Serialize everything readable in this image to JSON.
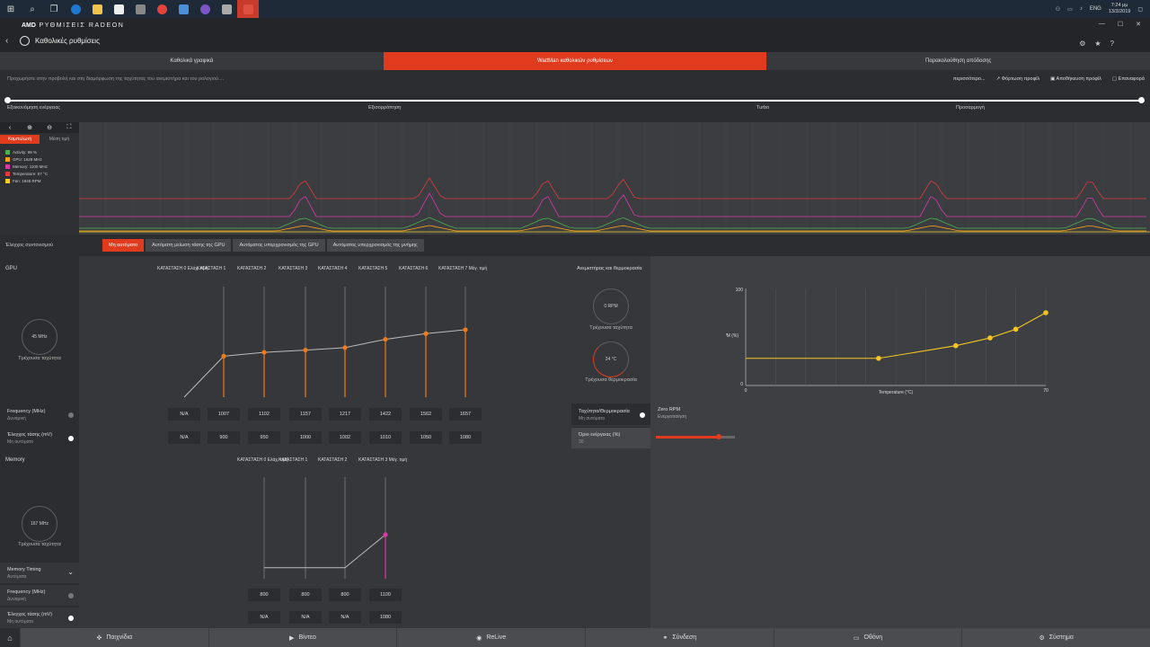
{
  "taskbar": {
    "icons": [
      "windows-icon",
      "search-icon",
      "task-view-icon",
      "edge-icon",
      "file-explorer-icon",
      "mail-icon",
      "calculator-icon",
      "chrome-icon",
      "store-icon",
      "viber-icon",
      "photos-icon",
      "radeon-icon"
    ],
    "lang": "ENG",
    "time": "7:24 μμ",
    "date": "13/3/2019"
  },
  "app": {
    "brand_bold": "AMD",
    "brand": "ΡΥΘΜΙΣΕΙΣ RADEON",
    "breadcrumb": "Καθολικές ρυθμίσεις"
  },
  "tabs": [
    "Καθολικά γραφικά",
    "WattMan καθολικών ρυθμίσεων",
    "Παρακολούθηση απόδοσης"
  ],
  "subbar": {
    "hint": "Προχωρήστε στην προβολή και στη διαμόρφωση της ταχύτητας του ανεμιστήρα και του ρολογιού....",
    "more": "περισσότερο...",
    "load": "Φόρτωση προφίλ",
    "save": "Αποθήκευση προφίλ",
    "reset": "Επαναφορά"
  },
  "presets": [
    "Εξοικονόμηση ενέργειας",
    "Εξισορρόπηση",
    "Turbo",
    "Προσαρμογή"
  ],
  "graph": {
    "mode_curve": "Καμπυλωτή",
    "mode_avg": "Μέση τιμή",
    "legend": [
      {
        "label": "Activity: 99 %",
        "color": "#4caf50"
      },
      {
        "label": "GPU: 1628 MHz",
        "color": "#f7a21b"
      },
      {
        "label": "Memory: 1100 MHz",
        "color": "#d63aa6"
      },
      {
        "label": "Temperature: 57 °C",
        "color": "#e03b3b"
      },
      {
        "label": "Fan: 1846 RPM",
        "color": "#f5d020"
      }
    ]
  },
  "fan_control": {
    "label": "Έλεγχος συντονισμού",
    "options": [
      "Μη αυτόματο",
      "Αυτόματη μείωση τάσης της GPU",
      "Αυτόματος υπερχρονισμός της GPU",
      "Αυτόματος υπερχρονισμός της μνήμης"
    ]
  },
  "gpu": {
    "title": "GPU",
    "speed": "45 MHz",
    "speed_label": "Τρέχουσα ταχύτητα",
    "freq_title": "Frequency (MHz)",
    "freq_sub": "Δυναμική",
    "volt_title": "Έλεγχος τάσης (mV)",
    "volt_sub": "Μη αυτόματο",
    "states": [
      "ΚΑΤΑΣΤΑΣΗ 0 Ελάχ. τιμή",
      "ΚΑΤΑΣΤΑΣΗ 1",
      "ΚΑΤΑΣΤΑΣΗ 2",
      "ΚΑΤΑΣΤΑΣΗ 3",
      "ΚΑΤΑΣΤΑΣΗ 4",
      "ΚΑΤΑΣΤΑΣΗ 5",
      "ΚΑΤΑΣΤΑΣΗ 6",
      "ΚΑΤΑΣΤΑΣΗ 7 Μέγ. τιμή"
    ],
    "freq": [
      "N/A",
      "1007",
      "1102",
      "1157",
      "1217",
      "1422",
      "1562",
      "1657"
    ],
    "volt": [
      "N/A",
      "900",
      "950",
      "1000",
      "1002",
      "1010",
      "1050",
      "1080"
    ]
  },
  "memory": {
    "title": "Memory",
    "speed": "167 MHz",
    "speed_label": "Τρέχουσα ταχύτητα",
    "timing_title": "Memory Timing",
    "timing_sub": "Αυτόματα",
    "freq_title": "Frequency (MHz)",
    "freq_sub": "Δυναμική",
    "volt_title": "Έλεγχος τάσης (mV)",
    "volt_sub": "Μη αυτόματο",
    "states": [
      "ΚΑΤΑΣΤΑΣΗ 0 Ελάχ. τιμή",
      "ΚΑΤΑΣΤΑΣΗ 1",
      "ΚΑΤΑΣΤΑΣΗ 2",
      "ΚΑΤΑΣΤΑΣΗ 3 Μέγ. τιμή"
    ],
    "freq": [
      "800",
      "800",
      "800",
      "1100"
    ],
    "volt": [
      "N/A",
      "N/A",
      "N/A",
      "1080"
    ]
  },
  "fan": {
    "title": "Ανεμιστήρας και θερμοκρασία",
    "rpm": "0 RPM",
    "rpm_label": "Τρέχουσα ταχύτητα",
    "temp": "24 °C",
    "temp_label": "Τρέχουσα θερμοκρασία",
    "speed_temp_title": "Ταχύτητα/Θερμοκρασία",
    "speed_temp_sub": "Μη αυτόματο",
    "zero_rpm_title": "Zero RPM",
    "zero_rpm_sub": "Ενεργοποίηση",
    "power_title": "Όριο ενέργειας (%)",
    "power_value": "30",
    "power_fraction": 0.8,
    "y_label": "PWM (%)",
    "x_label": "Temperature (°C)",
    "y_max": "100",
    "y_min": "0",
    "x_min": "0",
    "x_max": "70"
  },
  "bottom": [
    {
      "label": "Παιχνίδια",
      "icon": "gamepad-icon"
    },
    {
      "label": "Βίντεο",
      "icon": "play-icon"
    },
    {
      "label": "ReLive",
      "icon": "relive-icon"
    },
    {
      "label": "Σύνδεση",
      "icon": "connect-icon"
    },
    {
      "label": "Οθόνη",
      "icon": "monitor-icon"
    },
    {
      "label": "Σύστημα",
      "icon": "system-icon"
    }
  ]
}
